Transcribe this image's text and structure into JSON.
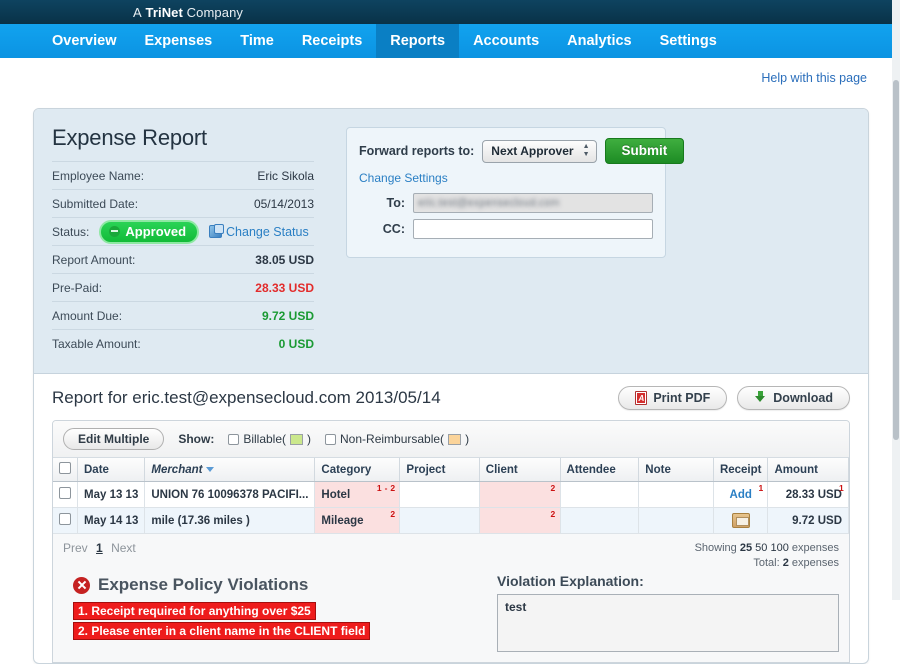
{
  "brand": {
    "prefix": "A",
    "name": "TriNet",
    "suffix": "Company"
  },
  "nav": {
    "items": [
      {
        "label": "Overview",
        "active": false
      },
      {
        "label": "Expenses",
        "active": false
      },
      {
        "label": "Time",
        "active": false
      },
      {
        "label": "Receipts",
        "active": false
      },
      {
        "label": "Reports",
        "active": true
      },
      {
        "label": "Accounts",
        "active": false
      },
      {
        "label": "Analytics",
        "active": false
      },
      {
        "label": "Settings",
        "active": false
      }
    ]
  },
  "help_link": "Help with this page",
  "summary": {
    "title": "Expense Report",
    "rows": [
      {
        "label": "Employee Name:",
        "value": "Eric Sikola",
        "style": "plain"
      },
      {
        "label": "Submitted Date:",
        "value": "05/14/2013",
        "style": "plain"
      },
      {
        "label": "Report Amount:",
        "value": "38.05 USD",
        "style": "bold"
      },
      {
        "label": "Pre-Paid:",
        "value": "28.33 USD",
        "style": "red"
      },
      {
        "label": "Amount Due:",
        "value": "9.72 USD",
        "style": "green"
      },
      {
        "label": "Taxable Amount:",
        "value": "0 USD",
        "style": "green"
      }
    ],
    "status_label": "Status:",
    "status_value": "Approved",
    "change_status": "Change Status"
  },
  "forward": {
    "label": "Forward reports to:",
    "select_value": "Next Approver",
    "submit_label": "Submit",
    "change_settings": "Change Settings",
    "to_label": "To:",
    "to_value": "eric.test@expensecloud.com",
    "cc_label": "CC:",
    "cc_value": ""
  },
  "report": {
    "title": "Report for eric.test@expensecloud.com 2013/05/14",
    "print_label": "Print PDF",
    "download_label": "Download"
  },
  "toolbar": {
    "edit_multiple": "Edit Multiple",
    "show_label": "Show:",
    "billable_label": "Billable(",
    "billable_close": ")",
    "nonreimb_label": "Non-Reimbursable(",
    "nonreimb_close": ")"
  },
  "table": {
    "columns": [
      "Date",
      "Merchant",
      "Category",
      "Project",
      "Client",
      "Attendee",
      "Note",
      "Receipt",
      "Amount"
    ],
    "sorted_column": "Merchant",
    "rows": [
      {
        "date": "May 13 13",
        "merchant": "UNION 76 10096378 PACIFI...",
        "category": "Hotel",
        "category_flag": "1 - 2",
        "project": "",
        "client": "",
        "client_flag": "2",
        "attendee": "",
        "note": "",
        "receipt": "Add",
        "receipt_flag": "1",
        "amount": "28.33 USD",
        "amount_flag": "1"
      },
      {
        "date": "May 14 13",
        "merchant": "mile (17.36 miles )",
        "category": "Mileage",
        "category_flag": "2",
        "project": "",
        "client": "",
        "client_flag": "2",
        "attendee": "",
        "note": "",
        "receipt": "",
        "receipt_flag": "",
        "amount": "9.72 USD",
        "amount_flag": ""
      }
    ]
  },
  "pager": {
    "prev": "Prev",
    "current": "1",
    "next": "Next"
  },
  "showing": {
    "prefix": "Showing",
    "opt_25": "25",
    "opt_50": "50",
    "opt_100": "100",
    "suffix": "expenses",
    "total_label": "Total:",
    "total_value": "2",
    "total_suffix": "expenses"
  },
  "violations": {
    "heading": "Expense Policy Violations",
    "items": [
      "1. Receipt required for anything over $25",
      "2. Please enter in a client name in the CLIENT field"
    ],
    "explanation_label": "Violation Explanation:",
    "explanation_value": "test"
  },
  "colors": {
    "brandbar": "#0d3f5c",
    "nav": "#0d9ae8",
    "nav_active": "#0a7fc4",
    "approved_green": "#1fc846",
    "link_blue": "#2a7fc4",
    "violation_red": "#ee1c1c",
    "amount_red": "#e22b2b",
    "amount_green": "#1a9a33",
    "panel_blue": "#dfeaf2"
  }
}
